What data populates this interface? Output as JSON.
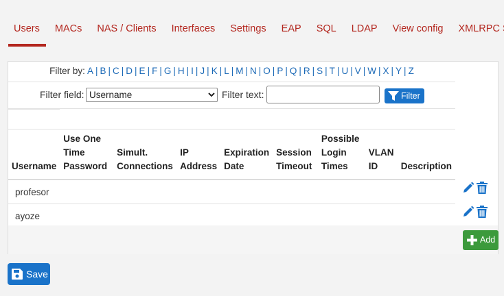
{
  "tabs": [
    {
      "label": "Users",
      "active": true
    },
    {
      "label": "MACs"
    },
    {
      "label": "NAS / Clients"
    },
    {
      "label": "Interfaces"
    },
    {
      "label": "Settings"
    },
    {
      "label": "EAP"
    },
    {
      "label": "SQL"
    },
    {
      "label": "LDAP"
    },
    {
      "label": "View config"
    },
    {
      "label": "XMLRPC Sync"
    }
  ],
  "filter_by": {
    "label": "Filter by:",
    "letters": [
      "A",
      "B",
      "C",
      "D",
      "E",
      "F",
      "G",
      "H",
      "I",
      "J",
      "K",
      "L",
      "M",
      "N",
      "O",
      "P",
      "Q",
      "R",
      "S",
      "T",
      "U",
      "V",
      "W",
      "X",
      "Y",
      "Z"
    ]
  },
  "filter": {
    "field_label": "Filter field:",
    "field_value": "Username",
    "text_label": "Filter text:",
    "text_value": "",
    "button_label": "Filter"
  },
  "table": {
    "columns": [
      "Username",
      "Use One Time Password",
      "Simult. Connections",
      "IP Address",
      "Expiration Date",
      "Session Timeout",
      "Possible Login Times",
      "VLAN ID",
      "Description"
    ],
    "rows": [
      {
        "username": "profesor"
      },
      {
        "username": "ayoze"
      }
    ]
  },
  "buttons": {
    "add": "Add",
    "save": "Save"
  },
  "colors": {
    "accent_red": "#b3261e",
    "primary_blue": "#1a73c9",
    "success_green": "#3c9a3c"
  }
}
